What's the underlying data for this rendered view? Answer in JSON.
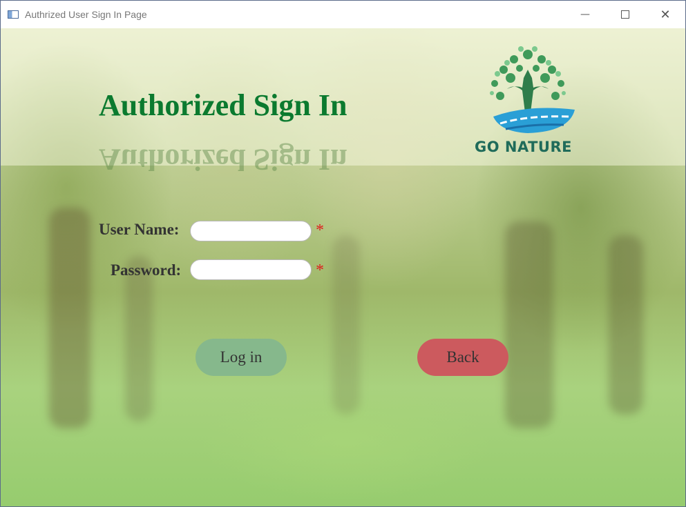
{
  "window": {
    "title": "Authrized User Sign In Page",
    "controls": {
      "minimize": "—",
      "maximize": "☐",
      "close": "✕"
    }
  },
  "header": {
    "heading": "Authorized Sign In",
    "logo_text": "GO NATURE"
  },
  "form": {
    "username_label": "User Name:",
    "password_label": "Password:",
    "required_marker": "*",
    "username_value": "",
    "password_value": ""
  },
  "buttons": {
    "login_label": "Log in",
    "back_label": "Back"
  },
  "colors": {
    "heading": "#0b7a2f",
    "login_button": "#86b88c",
    "back_button": "#cc5a5e",
    "required": "#e01e1e"
  }
}
